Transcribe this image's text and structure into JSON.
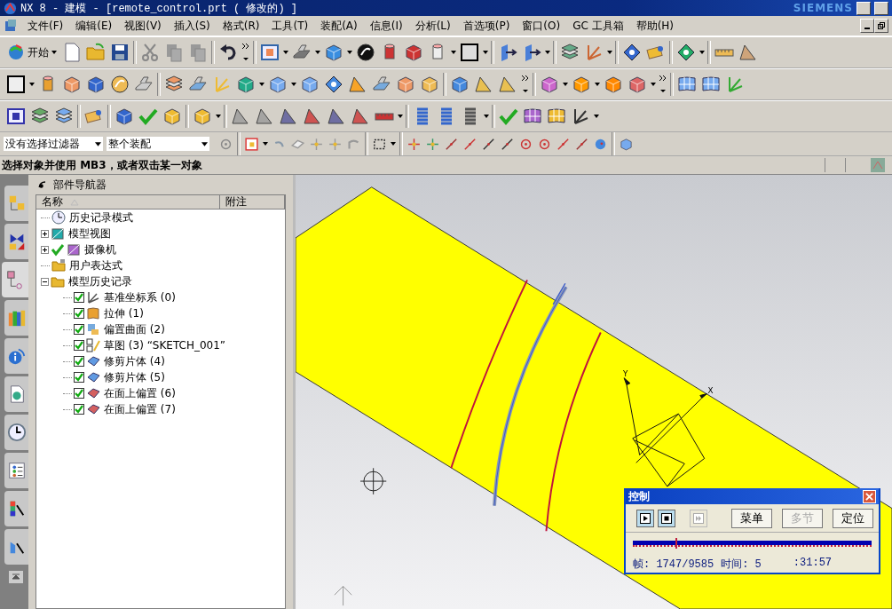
{
  "window": {
    "title": "NX 8 - 建模 - [remote_control.prt ( 修改的) ]",
    "brand": "SIEMENS"
  },
  "menu": [
    "文件(F)",
    "编辑(E)",
    "视图(V)",
    "插入(S)",
    "格式(R)",
    "工具(T)",
    "装配(A)",
    "信息(I)",
    "分析(L)",
    "首选项(P)",
    "窗口(O)",
    "GC 工具箱",
    "帮助(H)"
  ],
  "toolbar": {
    "start_label": "开始"
  },
  "filters": {
    "type_filter": "没有选择过滤器",
    "scope": "整个装配"
  },
  "cue_line": "选择对象并使用 MB3，或者双击某一对象",
  "side_tabs": [
    {
      "kind": "assembly",
      "selected": false
    },
    {
      "kind": "constraints",
      "selected": false
    },
    {
      "kind": "part",
      "selected": true
    },
    {
      "kind": "library",
      "selected": false
    },
    {
      "kind": "info",
      "selected": false
    },
    {
      "kind": "web",
      "selected": false
    },
    {
      "kind": "history",
      "selected": false
    },
    {
      "kind": "process",
      "selected": false
    },
    {
      "kind": "palette",
      "selected": false
    },
    {
      "kind": "wizard",
      "selected": false
    }
  ],
  "navigator": {
    "title": "部件导航器",
    "columns": [
      "名称",
      "附注"
    ],
    "tree": [
      {
        "label": "历史记录模式",
        "kind": "clock"
      },
      {
        "label": "模型视图",
        "kind": "view",
        "expanded": false
      },
      {
        "label": "摄像机",
        "kind": "camera",
        "expanded": false
      },
      {
        "label": "用户表达式",
        "kind": "expressions"
      },
      {
        "label": "模型历史记录",
        "kind": "folder",
        "expanded": true,
        "children": [
          {
            "label": "基准坐标系 (0)",
            "kind": "csys",
            "checked": true
          },
          {
            "label": "拉伸 (1)",
            "kind": "extrude",
            "checked": true
          },
          {
            "label": "偏置曲面 (2)",
            "kind": "offset",
            "checked": true
          },
          {
            "label": "草图 (3) “SKETCH_001”",
            "kind": "sketch",
            "checked": true
          },
          {
            "label": "修剪片体 (4)",
            "kind": "trim",
            "checked": true
          },
          {
            "label": "修剪片体 (5)",
            "kind": "trim",
            "checked": true
          },
          {
            "label": "在面上偏置 (6)",
            "kind": "face-offset",
            "checked": true
          },
          {
            "label": "在面上偏置 (7)",
            "kind": "face-offset",
            "checked": true
          }
        ]
      }
    ]
  },
  "viewport": {
    "axis_labels": [
      "Y",
      "X"
    ]
  },
  "control_dialog": {
    "title": "控制",
    "media": [
      {
        "kind": "play",
        "disabled": false
      },
      {
        "kind": "stop",
        "disabled": false
      },
      {
        "kind": "step",
        "disabled": true
      }
    ],
    "buttons": [
      {
        "label": "菜单",
        "disabled": false
      },
      {
        "label": "多节",
        "disabled": true
      },
      {
        "label": "定位",
        "disabled": false
      }
    ],
    "timeline": {
      "level": 0.18
    },
    "frame": "帧: 1747/9585",
    "time_start": "时间: 5",
    "time_end": ":31:57"
  }
}
